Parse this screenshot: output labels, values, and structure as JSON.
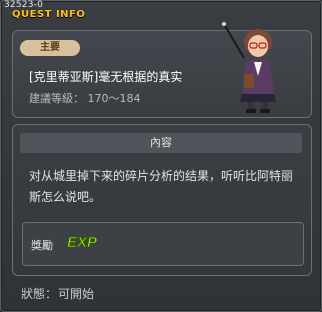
{
  "window": {
    "id": "32523-0",
    "title": "QUEST INFO"
  },
  "quest": {
    "category": "主要",
    "name": "[克里蒂亚斯]毫无根据的真实",
    "level": "建議等級： 170～184"
  },
  "npc": {
    "icon": "npc-scholar-portrait"
  },
  "content": {
    "header": "內容",
    "description": "对从城里掉下来的碎片分析的结果，听听比阿特丽斯怎么说吧。"
  },
  "reward": {
    "label": "獎勵",
    "exp_text": "EXP"
  },
  "status": {
    "label": "狀態：",
    "value": "可開始"
  },
  "colors": {
    "title": "#ffc21a",
    "badge": "#d8c09b",
    "exp_green": "#a8f11c"
  }
}
